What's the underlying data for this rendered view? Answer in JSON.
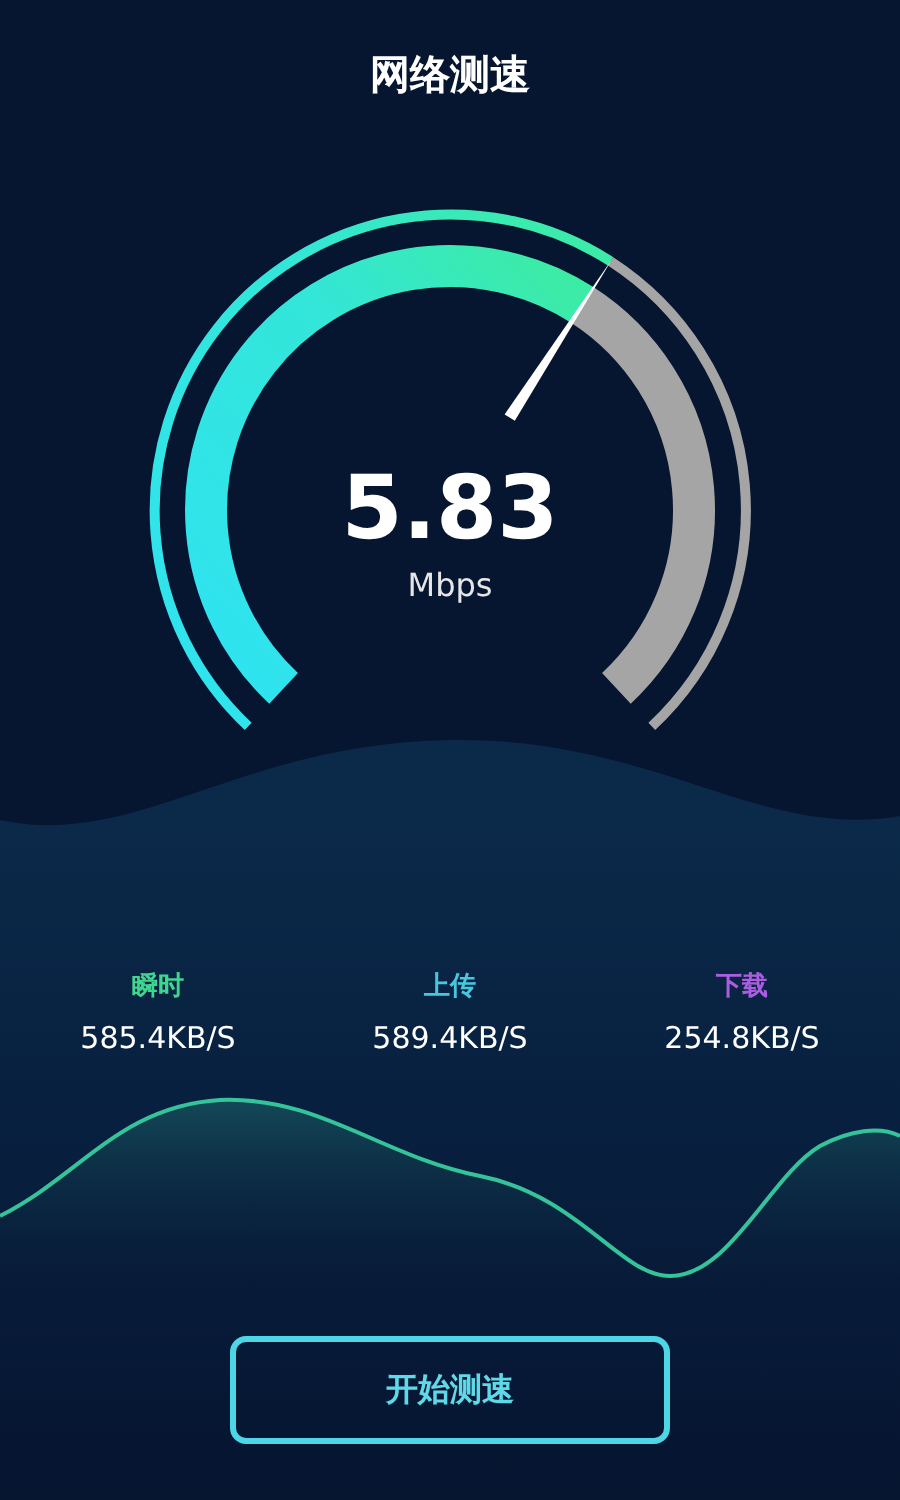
{
  "title": "网络测速",
  "gauge": {
    "value": "5.83",
    "unit": "Mbps"
  },
  "stats": [
    {
      "label": "瞬时",
      "value": "585.4KB/S",
      "color": "#3fd68f"
    },
    {
      "label": "上传",
      "value": "589.4KB/S",
      "color": "#46c7de"
    },
    {
      "label": "下载",
      "value": "254.8KB/S",
      "color": "#a95ee0"
    }
  ],
  "button": "开始测速"
}
